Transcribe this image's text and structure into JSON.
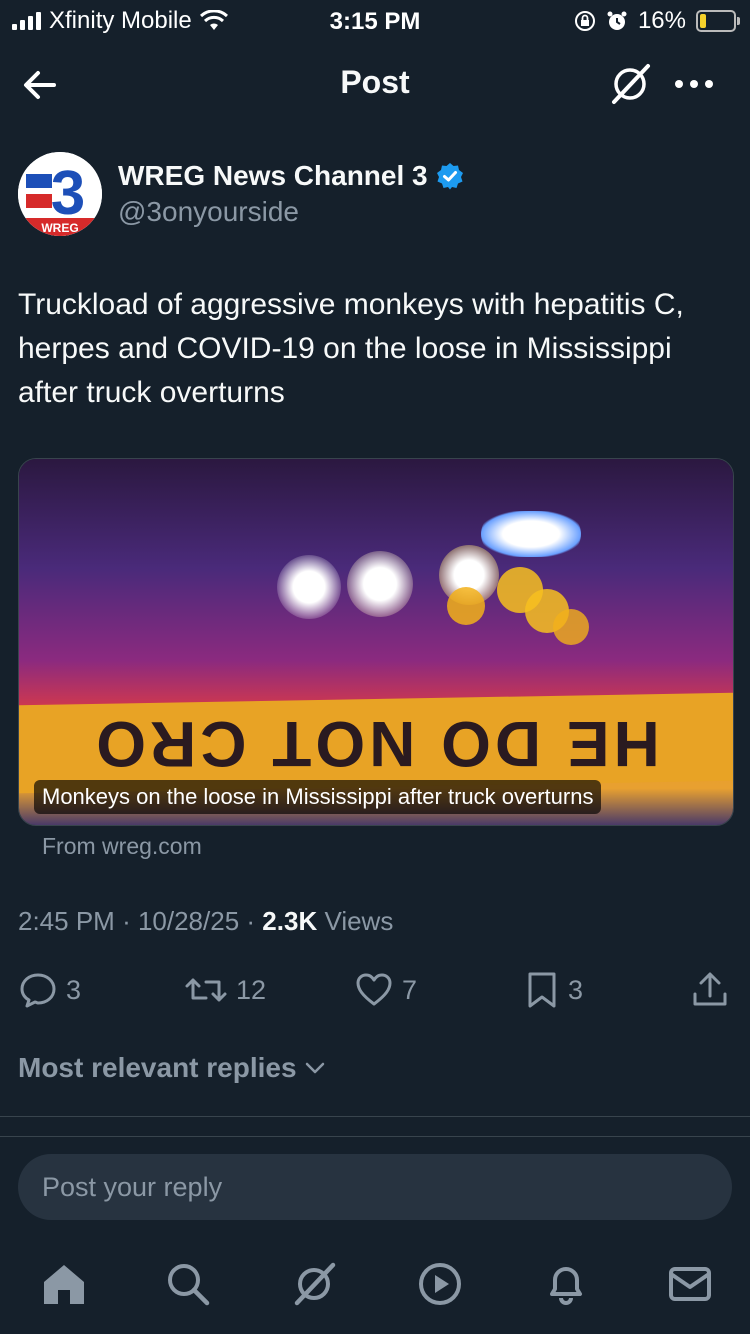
{
  "status_bar": {
    "carrier": "Xfinity Mobile",
    "time": "3:15 PM",
    "battery": "16%"
  },
  "header": {
    "title": "Post"
  },
  "author": {
    "name": "WREG News Channel 3",
    "handle": "@3onyourside",
    "avatar_text": "3",
    "avatar_sub": "WREG"
  },
  "tweet": {
    "text": "Truckload of aggressive monkeys with hepatitis C, herpes and COVID-19 on the loose in Mississippi after truck overturns",
    "card_caption": "Monkeys on the loose in Mississippi after truck overturns",
    "card_source": "From wreg.com",
    "tape_text": "HE DO NOT CRO",
    "time": "2:45 PM",
    "date": "10/28/25",
    "views_count": "2.3K",
    "views_label": "Views"
  },
  "actions": {
    "replies": "3",
    "reposts": "12",
    "likes": "7",
    "bookmarks": "3"
  },
  "replies_filter": {
    "label": "Most relevant replies"
  },
  "reply_input": {
    "placeholder": "Post your reply"
  },
  "colors": {
    "background": "#15202b",
    "verified": "#1d9bf0",
    "muted": "#8b98a5"
  },
  "bottom_nav": [
    "home-icon",
    "search-icon",
    "grok-icon",
    "video-icon",
    "notifications-icon",
    "messages-icon"
  ]
}
